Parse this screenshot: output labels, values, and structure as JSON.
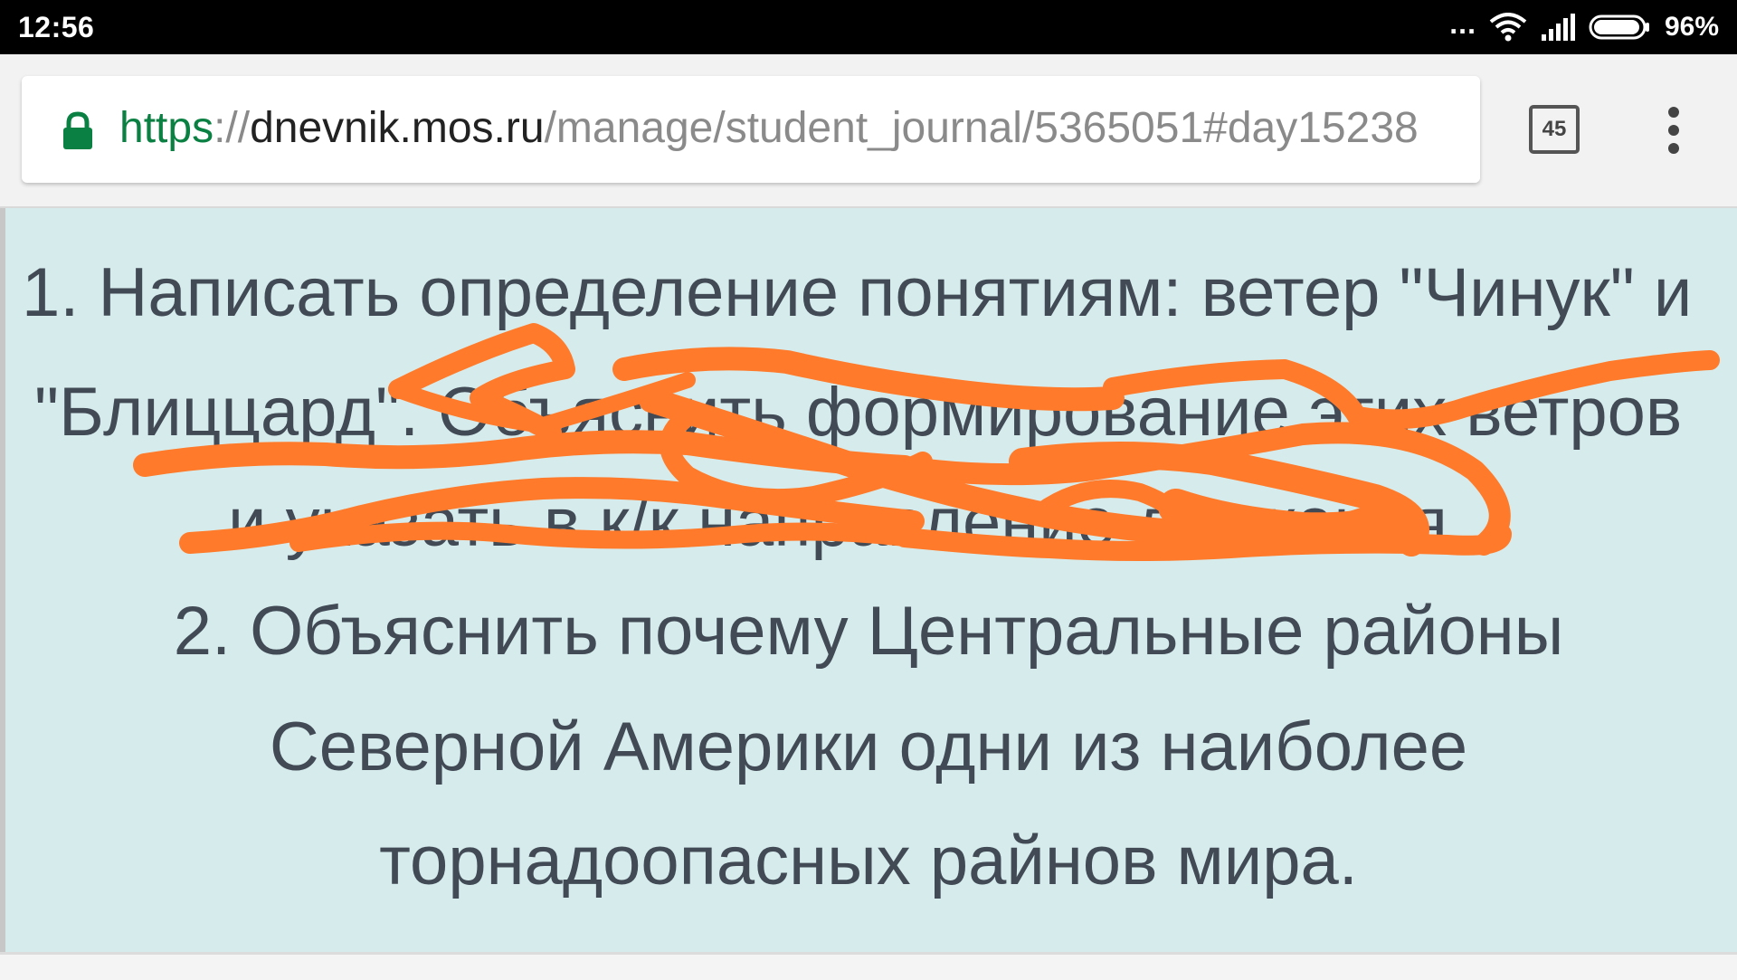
{
  "status_bar": {
    "time": "12:56",
    "dots": "...",
    "battery_percent": "96%",
    "icons": [
      "wifi-icon",
      "signal-icon",
      "battery-icon"
    ]
  },
  "browser": {
    "url": {
      "scheme": "https",
      "separator": "://",
      "host": "dnevnik.mos.ru",
      "path": "/manage/student_journal/5365051#day15238",
      "secure_icon": "lock-icon"
    },
    "tab_count": "45",
    "menu_icon": "more-vertical-icon"
  },
  "homework": {
    "line1": "1. Написать определение понятиям: ветер \"Чинук\" и",
    "line2": "\"Блиццард\". Объяснить формирование этих ветров",
    "line3": "и указать в к/к направление движения.",
    "line4": "2. Объяснить почему Центральные районы",
    "line5": "Северной Америки одни из наиболее",
    "line6": "торнадоопасных райнов мира."
  },
  "colors": {
    "content_bg": "#d6ecec",
    "scribble": "#ff7a2a",
    "secure_green": "#0b8043"
  }
}
